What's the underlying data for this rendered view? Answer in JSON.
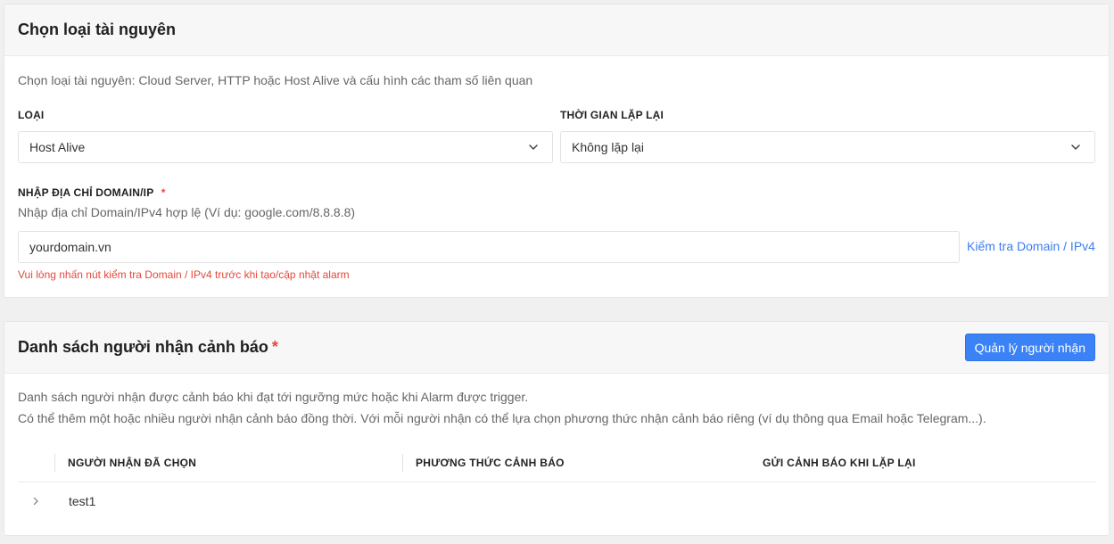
{
  "resource_section": {
    "title": "Chọn loại tài nguyên",
    "description": "Chọn loại tài nguyên: Cloud Server, HTTP hoặc Host Alive và cấu hình các tham số liên quan",
    "type_label": "LOẠI",
    "type_value": "Host Alive",
    "repeat_label": "THỜI GIAN LẶP LẠI",
    "repeat_value": "Không lặp lại",
    "domain_label": "NHẬP ĐỊA CHỈ DOMAIN/IP",
    "domain_required": "*",
    "domain_hint": "Nhập địa chỉ Domain/IPv4 hợp lệ (Ví dụ: google.com/8.8.8.8)",
    "domain_value": "yourdomain.vn",
    "check_link": "Kiểm tra Domain / IPv4",
    "error": "Vui lòng nhấn nút kiểm tra Domain / IPv4 trước khi tạo/cập nhật alarm"
  },
  "recipients_section": {
    "title": "Danh sách người nhận cảnh báo",
    "required": "*",
    "manage_button": "Quản lý người nhận",
    "description_1": "Danh sách người nhận được cảnh báo khi đạt tới ngưỡng mức hoặc khi Alarm được trigger.",
    "description_2": "Có thể thêm một hoặc nhiều người nhận cảnh báo đồng thời. Với mỗi người nhận có thể lựa chọn phương thức nhận cảnh báo riêng (ví dụ thông qua Email hoặc Telegram...).",
    "columns": [
      "NGƯỜI NHẬN ĐÃ CHỌN",
      "PHƯƠNG THỨC CẢNH BÁO",
      "GỬI CẢNH BÁO KHI LẶP LẠI"
    ],
    "rows": [
      {
        "name": "test1"
      }
    ]
  },
  "icons": {
    "select_arrow": "chevron-down-icon",
    "row_expand": "chevron-right-icon"
  },
  "colors": {
    "accent": "#3b82f6",
    "link": "#3d7ef0",
    "error": "#e5483c"
  }
}
